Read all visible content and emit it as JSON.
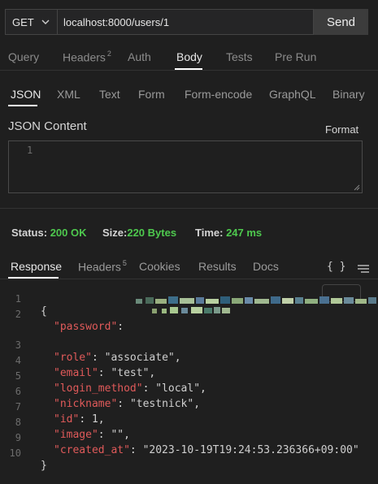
{
  "request": {
    "method": "GET",
    "url": "localhost:8000/users/1",
    "send_label": "Send"
  },
  "request_tabs": [
    {
      "label": "Query"
    },
    {
      "label": "Headers",
      "count": "2"
    },
    {
      "label": "Auth"
    },
    {
      "label": "Body",
      "active": true
    },
    {
      "label": "Tests"
    },
    {
      "label": "Pre Run"
    }
  ],
  "body_types": [
    {
      "label": "JSON",
      "active": true
    },
    {
      "label": "XML"
    },
    {
      "label": "Text"
    },
    {
      "label": "Form"
    },
    {
      "label": "Form-encode"
    },
    {
      "label": "GraphQL"
    },
    {
      "label": "Binary"
    }
  ],
  "json_content": {
    "label": "JSON Content",
    "format_label": "Format",
    "line_numbers": [
      "1"
    ]
  },
  "status": {
    "status_label": "Status:",
    "status_value": "200 OK",
    "size_label": "Size:",
    "size_value": "220 Bytes",
    "time_label": "Time:",
    "time_value": "247 ms"
  },
  "response_tabs": [
    {
      "label": "Response",
      "active": true
    },
    {
      "label": "Headers",
      "count": "5"
    },
    {
      "label": "Cookies"
    },
    {
      "label": "Results"
    },
    {
      "label": "Docs"
    }
  ],
  "response_icons": [
    "braces-icon",
    "menu-icon"
  ],
  "response_body": {
    "line_numbers": [
      "1",
      "2",
      "",
      "3",
      "4",
      "5",
      "6",
      "7",
      "8",
      "9",
      "10"
    ],
    "open_brace": "{",
    "close_brace": "}",
    "password_key": "\"password\"",
    "role_key": "\"role\"",
    "role_value": "\"associate\"",
    "email_key": "\"email\"",
    "email_value": "\"test\"",
    "login_method_key": "\"login_method\"",
    "login_method_value": "\"local\"",
    "nickname_key": "\"nickname\"",
    "nickname_value": "\"testnick\"",
    "id_key": "\"id\"",
    "id_value": "1",
    "image_key": "\"image\"",
    "image_value": "\"\"",
    "created_at_key": "\"created_at\"",
    "created_at_value": "\"2023-10-19T19:24:53.236366+09:00\""
  },
  "colors": {
    "background": "#1f1f1f",
    "accent_status": "#4ec94e",
    "json_key": "#e05a5a"
  }
}
